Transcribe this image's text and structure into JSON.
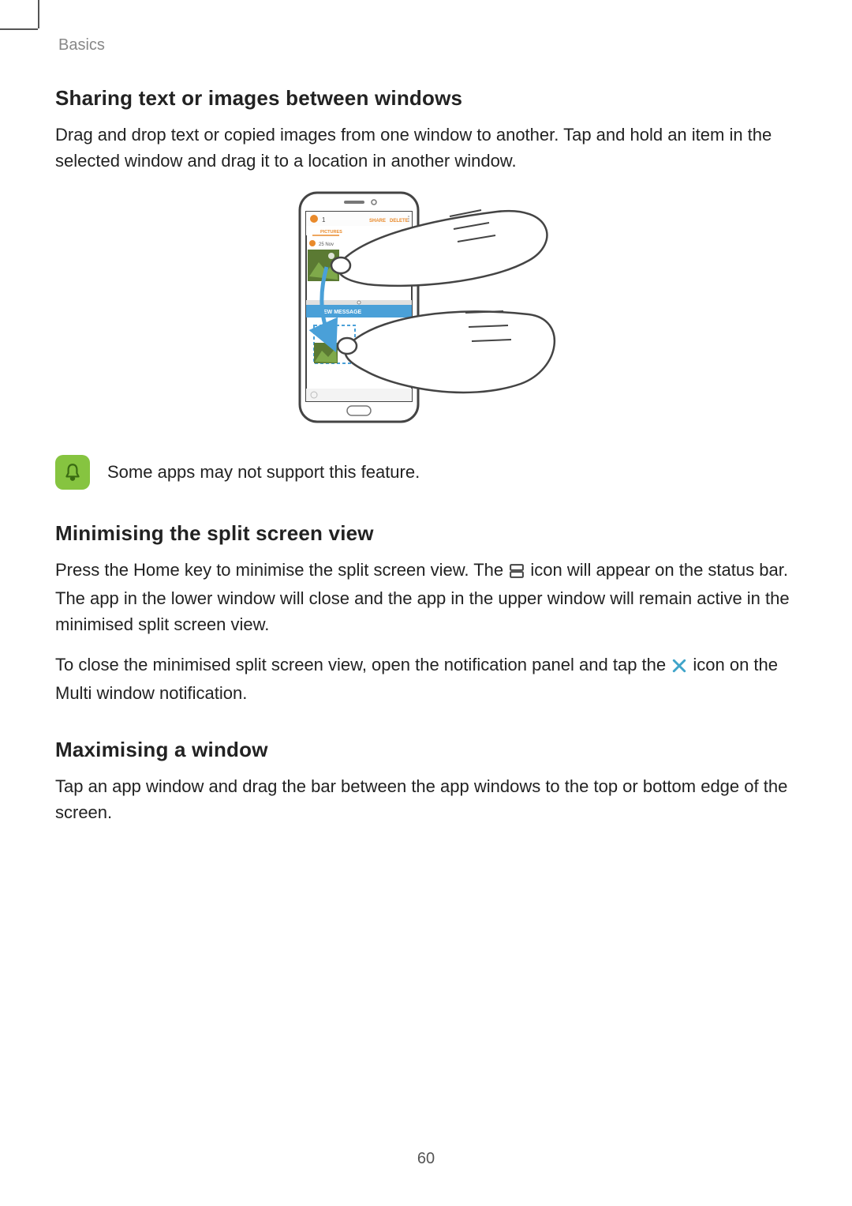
{
  "header": {
    "section": "Basics"
  },
  "sections": {
    "sharing": {
      "title": "Sharing text or images between windows",
      "body": "Drag and drop text or copied images from one window to another. Tap and hold an item in the selected window and drag it to a location in another window."
    },
    "note": {
      "text": "Some apps may not support this feature."
    },
    "minimise": {
      "title": "Minimising the split screen view",
      "body_a": "Press the Home key to minimise the split screen view. The ",
      "body_b": " icon will appear on the status bar. The app in the lower window will close and the app in the upper window will remain active in the minimised split screen view.",
      "body2_a": "To close the minimised split screen view, open the notification panel and tap the ",
      "body2_b": " icon on the Multi window notification."
    },
    "maximise": {
      "title": "Maximising a window",
      "body": "Tap an app window and drag the bar between the app windows to the top or bottom edge of the screen."
    }
  },
  "figure": {
    "top_app": {
      "count": "1",
      "share": "SHARE",
      "delete": "DELETE",
      "tab1": "PICTURES",
      "date": "25 Nov"
    },
    "bottom_app": {
      "banner": "EW MESSAGE"
    }
  },
  "icons": {
    "split_screen": "split-screen-icon",
    "close_x": "close-icon",
    "bell": "bell-icon"
  },
  "colors": {
    "note_bg": "#86c440",
    "accent_orange": "#e98a2b",
    "accent_blue": "#4aa0d8",
    "close_x": "#3fa4c9"
  },
  "page_number": "60"
}
